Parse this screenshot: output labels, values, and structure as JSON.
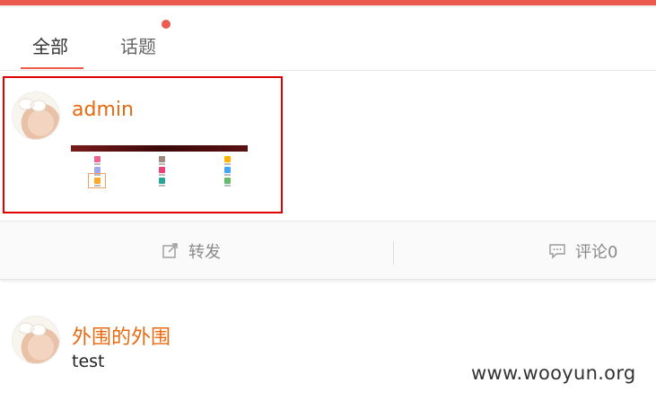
{
  "tabs": [
    {
      "label": "全部",
      "active": true
    },
    {
      "label": "话题",
      "active": false,
      "has_dot": true
    }
  ],
  "posts": [
    {
      "author": "admin",
      "has_image": true
    },
    {
      "author": "外围的外围",
      "text": "test"
    }
  ],
  "actions": {
    "forward_label": "转发",
    "comment_label": "评论0"
  },
  "watermark": "www.wooyun.org",
  "colors": {
    "accent": "#ed5b4e",
    "author": "#e8690f",
    "highlight": "#e00000"
  }
}
